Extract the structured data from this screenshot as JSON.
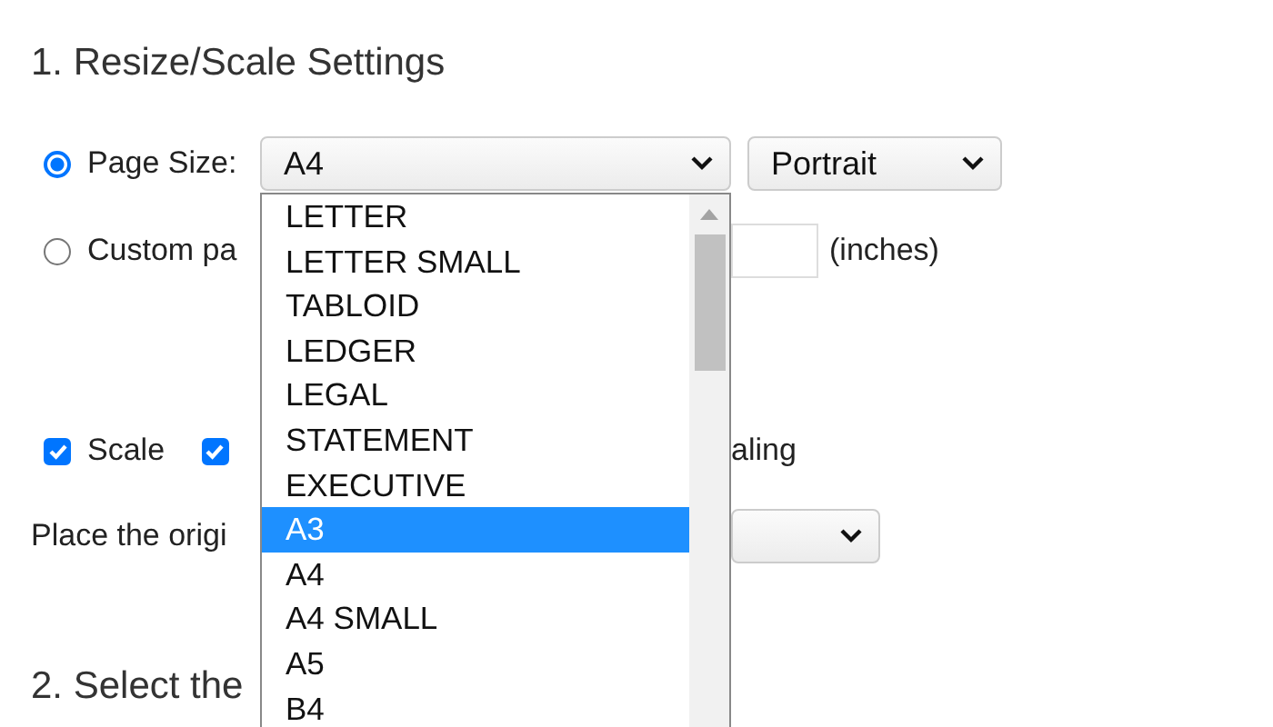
{
  "section_title": "1. Resize/Scale Settings",
  "page_size": {
    "selected": true,
    "label": "Page Size:",
    "value": "A4",
    "orientation": "Portrait"
  },
  "custom": {
    "selected": false,
    "label": "Custom pa",
    "unit": "(inches)"
  },
  "checks": [
    {
      "label": "Scale",
      "checked": true
    },
    {
      "label": "aling",
      "checked": true
    }
  ],
  "place": {
    "label": "Place the origi"
  },
  "dropdown": {
    "options": [
      {
        "label": "LETTER",
        "selected": false
      },
      {
        "label": "LETTER SMALL",
        "selected": false
      },
      {
        "label": "TABLOID",
        "selected": false
      },
      {
        "label": "LEDGER",
        "selected": false
      },
      {
        "label": "LEGAL",
        "selected": false
      },
      {
        "label": "STATEMENT",
        "selected": false
      },
      {
        "label": "EXECUTIVE",
        "selected": false
      },
      {
        "label": "A3",
        "selected": true
      },
      {
        "label": "A4",
        "selected": false
      },
      {
        "label": "A4 SMALL",
        "selected": false
      },
      {
        "label": "A5",
        "selected": false
      },
      {
        "label": "B4",
        "selected": false
      }
    ]
  },
  "next_section": "2. Select the"
}
